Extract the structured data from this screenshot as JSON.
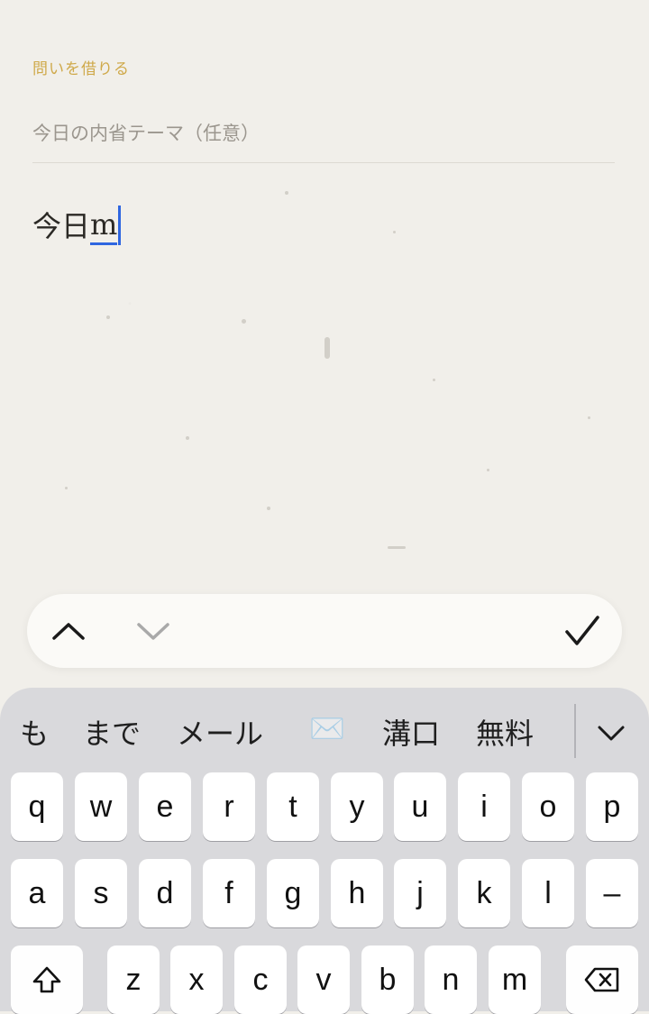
{
  "header": {
    "borrow_link": "問いを借りる"
  },
  "theme_field": {
    "placeholder": "今日の内省テーマ（任意）"
  },
  "editor": {
    "text": "今日",
    "marked_text": "m"
  },
  "input_toolbar": {
    "prev_icon": "chevron-up-icon",
    "next_icon": "chevron-down-icon",
    "done_icon": "checkmark-icon"
  },
  "keyboard": {
    "candidates": [
      "も",
      "まで",
      "メール",
      "✉️",
      "溝口",
      "無料"
    ],
    "row1": [
      "q",
      "w",
      "e",
      "r",
      "t",
      "y",
      "u",
      "i",
      "o",
      "p"
    ],
    "row2": [
      "a",
      "s",
      "d",
      "f",
      "g",
      "h",
      "j",
      "k",
      "l",
      "–"
    ],
    "row3": [
      "z",
      "x",
      "c",
      "v",
      "b",
      "n",
      "m"
    ]
  }
}
